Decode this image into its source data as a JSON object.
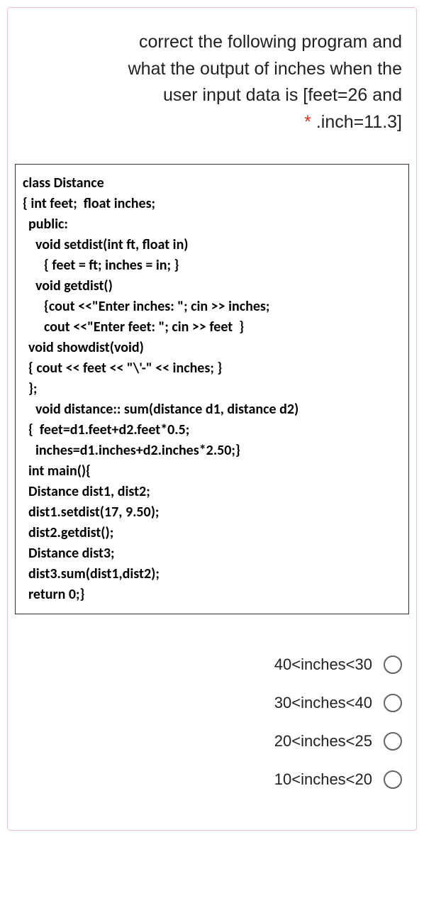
{
  "question": {
    "line1": "correct the following program and",
    "line2": "what the output of inches when the",
    "line3": "user input data is [feet=26 and",
    "line4": ".inch=11.3]",
    "required": "*"
  },
  "code": {
    "l1": "class Distance",
    "l2": "{ int feet;  float inches;",
    "l3": "public:",
    "l4": "void setdist(int ft, float in)",
    "l5": "{ feet = ft; inches = in; }",
    "l6": "void getdist()",
    "l7": "{cout <<\"Enter inches: \"; cin >> inches;",
    "l8": "cout <<\"Enter feet: \"; cin >> feet  }",
    "l9": "void showdist(void)",
    "l10": "{ cout << feet << \"\\'-\" << inches; }",
    "l11": "};",
    "l12": "void distance:: sum(distance d1, distance d2)",
    "l13": "{  feet=d1.feet+d2.feet*0.5;",
    "l14": "inches=d1.inches+d2.inches*2.50;}",
    "l15": "int main(){",
    "l16": "Distance dist1, dist2;",
    "l17": "dist1.setdist(17, 9.50);",
    "l18": "dist2.getdist();",
    "l19": "Distance dist3;",
    "l20": "dist3.sum(dist1,dist2);",
    "l21": "return 0;}"
  },
  "options": {
    "opt1": "40<inches<30",
    "opt2": "30<inches<40",
    "opt3": "20<inches<25",
    "opt4": "10<inches<20"
  }
}
